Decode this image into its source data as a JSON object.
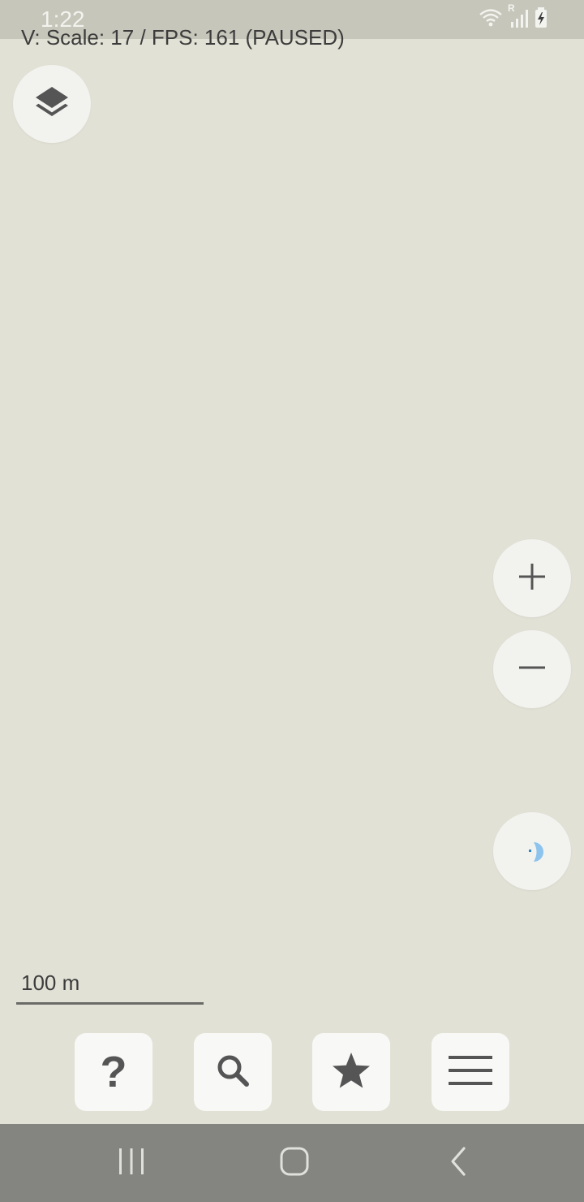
{
  "status_bar": {
    "time": "1:22",
    "icons": [
      "wifi-icon",
      "signal-roaming-icon",
      "battery-charging-icon"
    ],
    "roaming_letter": "R"
  },
  "debug": {
    "text": "V: Scale: 17 / FPS: 161 (PAUSED)"
  },
  "map": {
    "background_color": "#e2e1d5",
    "scale_label": "100 m"
  },
  "controls": {
    "layers_icon": "layers-icon",
    "zoom_in_icon": "plus-icon",
    "zoom_out_icon": "minus-icon",
    "location_icon": "my-location-icon"
  },
  "toolbar": {
    "help_glyph": "?",
    "items": [
      "help-icon",
      "search-icon",
      "star-icon",
      "menu-icon"
    ]
  },
  "nav_bar": {
    "items": [
      "recents-icon",
      "home-icon",
      "back-icon"
    ]
  },
  "colors": {
    "icon": "#555555",
    "location_accent": "#8cc4ee"
  }
}
